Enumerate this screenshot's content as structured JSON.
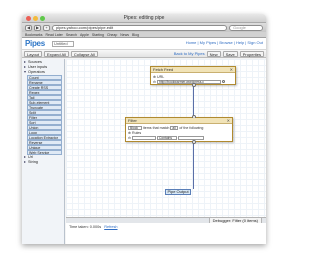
{
  "window": {
    "title": "Pipes: editing pipe",
    "url": "pipes.yahoo.com/pipes/pipe.edit",
    "search_placeholder": "Google"
  },
  "bookmarks": [
    "Bookmarks",
    "Read Later",
    "Search",
    "Apple",
    "Starting",
    "Cheap",
    "News",
    "Blog"
  ],
  "header": {
    "logo": "Pipes",
    "pipe_title": "Untitled",
    "nav": "Home | My Pipes | Browse | Help | Sign Out"
  },
  "toolbar": {
    "layout": "Layout",
    "expand_all": "Expand All",
    "collapse_all": "Collapse All",
    "back_link": "Back to My Pipes",
    "new": "New",
    "save": "Save",
    "properties": "Properties"
  },
  "sidebar": {
    "cat_sources": "Sources",
    "cat_user_inputs": "User inputs",
    "cat_operators": "Operators",
    "operators": [
      "Count",
      "Rename",
      "Create RSS",
      "Regex",
      "Tail",
      "Sub-element",
      "Truncate",
      "Split",
      "Filter",
      "Sort",
      "Union",
      "Loop",
      "Location Extractor",
      "Reverse",
      "Unique",
      "Web Service"
    ],
    "cat_url": "Url",
    "cat_string": "String"
  },
  "fetch_feed": {
    "title": "Fetch Feed",
    "url_label": "URL",
    "url_value": "http://bookwarmer.wordpress.c"
  },
  "filter": {
    "title": "Filter",
    "mode": "Block",
    "items_text": "items that match",
    "match": "all",
    "tail_text": "of the following",
    "rules_label": "Rules",
    "op": "Contains"
  },
  "output": {
    "label": "Pipe Output"
  },
  "debugger": {
    "tab": "Debugger: Filter (0 items)",
    "time_label": "Time taken: 0.000s",
    "refresh": "Refresh"
  },
  "colors": {
    "sidebar_item": "#dfe9f5",
    "module_header": "#f1e3b7",
    "wire": "#5a6fa8",
    "logo": "#2f77c7"
  }
}
